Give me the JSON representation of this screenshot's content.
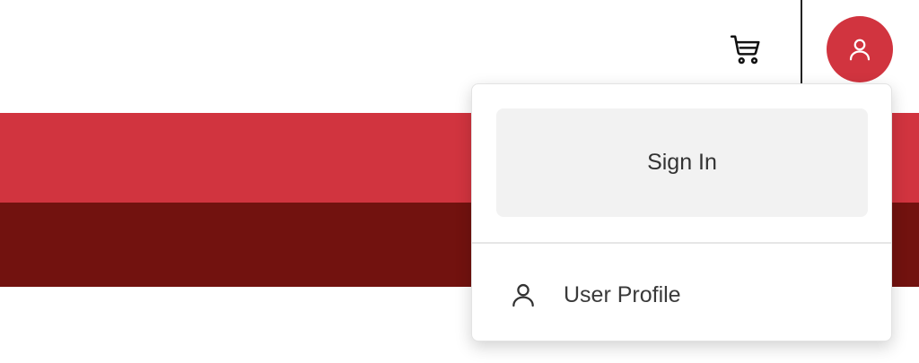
{
  "header": {
    "cart_icon": "shopping-cart-icon",
    "avatar_icon": "user-icon"
  },
  "dropdown": {
    "sign_in_label": "Sign In",
    "profile_label": "User Profile",
    "profile_icon": "user-icon"
  },
  "colors": {
    "accent": "#d1343f",
    "dark_band": "#72120f"
  }
}
